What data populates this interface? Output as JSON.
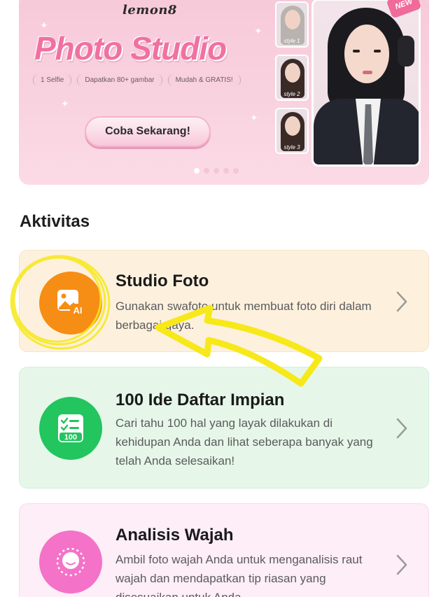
{
  "banner": {
    "brand": "lemon8",
    "title": "Photo Studio",
    "tags": [
      "1 Selfie",
      "Dapatkan 80+ gambar",
      "Mudah & GRATIS!"
    ],
    "cta_label": "Coba Sekarang!",
    "new_badge": "NEW",
    "styles": [
      "style 1",
      "style 2",
      "style 3"
    ],
    "carousel_count": 5,
    "carousel_active": 1
  },
  "section": {
    "title": "Aktivitas"
  },
  "cards": [
    {
      "title": "Studio Foto",
      "description": "Gunakan swafoto untuk membuat foto diri dalam berbagai gaya.",
      "icon": "ai-photo-icon",
      "bg_color": "#fdf1de",
      "icon_color": "#f68d14"
    },
    {
      "title": "100 Ide Daftar Impian",
      "description": "Cari tahu 100 hal yang layak dilakukan di kehidupan Anda dan lihat seberapa banyak yang telah Anda selesaikan!",
      "icon": "checklist-100-icon",
      "bg_color": "#e6f7ea",
      "icon_color": "#22c55e"
    },
    {
      "title": "Analisis Wajah",
      "description": "Ambil foto wajah Anda untuk menganalisis raut wajah dan mendapatkan tip riasan yang disesuaikan untuk Anda.",
      "icon": "face-scan-icon",
      "bg_color": "#fdeef8",
      "icon_color": "#f472c8"
    }
  ],
  "annotation": {
    "arrow_color": "#f7e81a"
  }
}
